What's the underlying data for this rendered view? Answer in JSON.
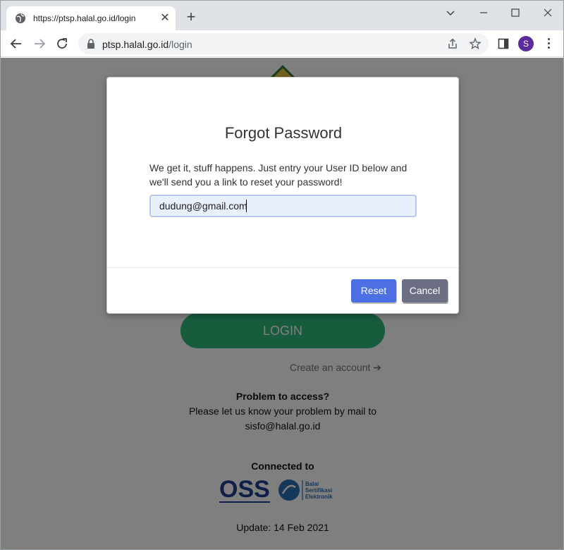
{
  "browser": {
    "tab_title": "https://ptsp.halal.go.id/login",
    "url_host": "ptsp.halal.go.id",
    "url_path": "/login",
    "profile_initial": "S",
    "profile_color": "#5b2a9c"
  },
  "page": {
    "login_label": "LOGIN",
    "create_account": "Create an account",
    "problem_title": "Problem to access?",
    "problem_text": "Please let us know your problem by mail to",
    "problem_email": "sisfo@halal.go.id",
    "connected_to": "Connected to",
    "oss_logo_text": "OSS",
    "bse_logo_text": [
      "Balai",
      "Sertifikasi",
      "Elektronik"
    ],
    "update": "Update: 14 Feb 2021"
  },
  "modal": {
    "title": "Forgot Password",
    "description": "We get it, stuff happens. Just entry your User ID below and we'll send you a link to reset your password!",
    "input_value": "dudung@gmail.com",
    "reset_label": "Reset",
    "cancel_label": "Cancel"
  },
  "colors": {
    "login_button": "#2db87b",
    "reset_button": "#4c6fe3",
    "cancel_button": "#6c6f83",
    "input_background": "#e8f0fe"
  }
}
